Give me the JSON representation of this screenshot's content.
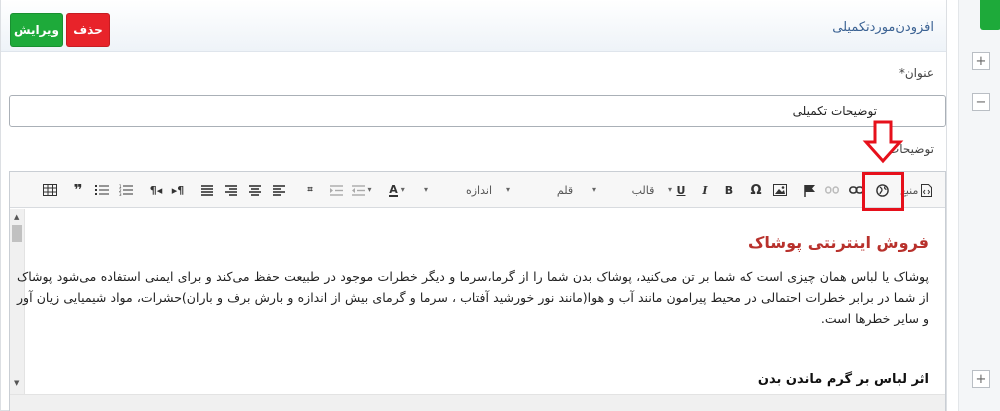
{
  "panel": {
    "title": "افزودن‌موردتکمیلی",
    "edit_label": "ویرایش",
    "delete_label": "حذف"
  },
  "form": {
    "title_label": "عنوان*",
    "title_value": "توضیحات تکمیلی",
    "desc_label": "توضیحات"
  },
  "toolbar": {
    "font_label": "قلم",
    "size_label": "اندازه",
    "format_label": "قالب",
    "source_label": "منبع"
  },
  "document": {
    "heading": "فروش اینترنتی پوشاک",
    "paragraph": "پوشاک یا لباس همان چیزی است که شما بر تن می‌کنید، پوشاک بدن شما را از گرما،سرما و دیگر خطرات موجود در طبیعت حفظ می‌کند و برای ایمنی استفاده می‌شود پوشاک از شما در برابر خطرات احتمالی در محیط پیرامون مانند آب و هوا(مانند نور خورشید آفتاب ، سرما و گرمای بیش از اندازه و بارش برف و باران)حشرات، مواد شیمیایی زیان آور و سایر خطرها است.",
    "subheading": "اثر لباس بر گرم ماندن بدن"
  },
  "sidebar": {
    "add_label": "+",
    "remove_label": "−",
    "add_bottom_label": "+"
  },
  "colors": {
    "edit": "#1eaa3a",
    "delete": "#e8232a",
    "heading": "#b8312c",
    "annotation": "#e6101b"
  }
}
